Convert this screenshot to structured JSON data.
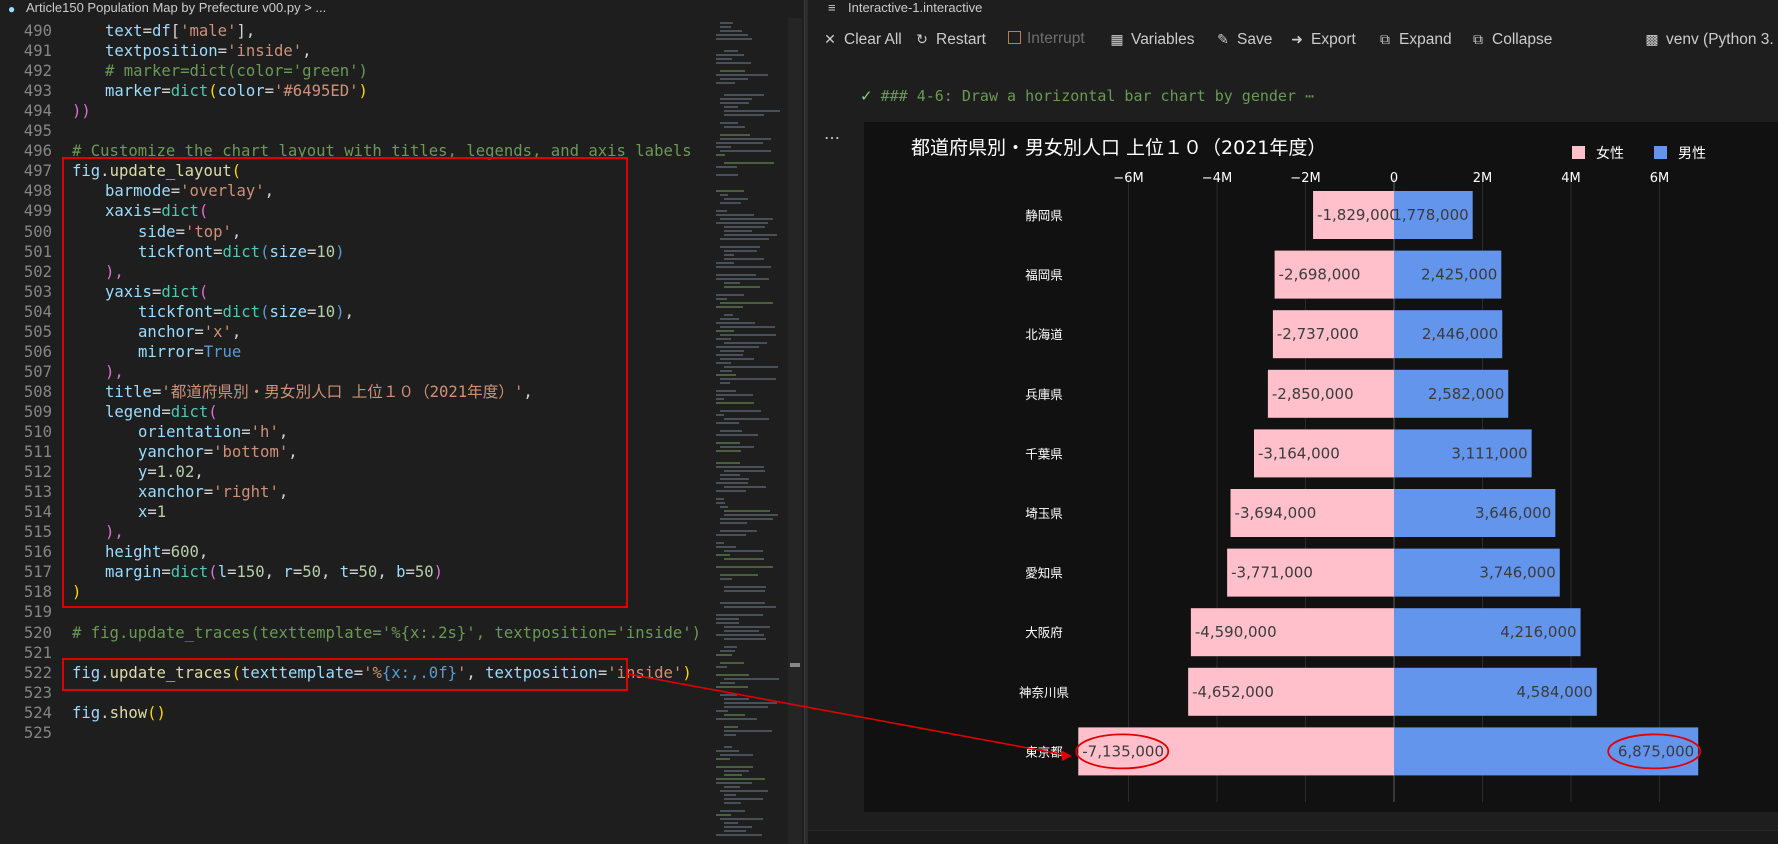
{
  "editor": {
    "breadcrumb": "Article150 Population Map by Prefecture v00.py > ...",
    "lines": [
      {
        "n": "490",
        "tokens": [
          [
            "t-var",
            "text"
          ],
          [
            "",
            "="
          ],
          [
            "t-var",
            "df"
          ],
          [
            "",
            "["
          ],
          [
            "t-str",
            "'male'"
          ],
          [
            "",
            "],"
          ]
        ]
      },
      {
        "n": "491",
        "tokens": [
          [
            "t-var",
            "textposition"
          ],
          [
            "",
            "="
          ],
          [
            "t-str",
            "'inside'"
          ],
          [
            "",
            ","
          ]
        ]
      },
      {
        "n": "492",
        "tokens": [
          [
            "t-com",
            "# marker=dict(color='green')"
          ]
        ]
      },
      {
        "n": "493",
        "tokens": [
          [
            "t-var",
            "marker"
          ],
          [
            "",
            "="
          ],
          [
            "t-cls",
            "dict"
          ],
          [
            "t-p2",
            "("
          ],
          [
            "t-var",
            "color"
          ],
          [
            "",
            "="
          ],
          [
            "t-str",
            "'#6495ED'"
          ],
          [
            "t-p2",
            ")"
          ]
        ]
      },
      {
        "n": "494",
        "tokens": [
          [
            "t-p1",
            "))"
          ]
        ]
      },
      {
        "n": "495",
        "tokens": []
      },
      {
        "n": "496",
        "tokens": [
          [
            "t-com",
            "# Customize the chart layout with titles, legends, and axis labels"
          ]
        ]
      },
      {
        "n": "497",
        "tokens": [
          [
            "t-var",
            "fig"
          ],
          [
            "",
            "."
          ],
          [
            "t-fn",
            "update_layout"
          ],
          [
            "t-p2",
            "("
          ]
        ]
      },
      {
        "n": "498",
        "tokens": [
          [
            "t-var",
            "barmode"
          ],
          [
            "",
            "="
          ],
          [
            "t-str",
            "'overlay'"
          ],
          [
            "",
            ","
          ]
        ]
      },
      {
        "n": "499",
        "tokens": [
          [
            "t-var",
            "xaxis"
          ],
          [
            "",
            "="
          ],
          [
            "t-cls",
            "dict"
          ],
          [
            "t-p1",
            "("
          ]
        ]
      },
      {
        "n": "500",
        "tokens": [
          [
            "t-var",
            "side"
          ],
          [
            "",
            "="
          ],
          [
            "t-str",
            "'top'"
          ],
          [
            "",
            ","
          ]
        ]
      },
      {
        "n": "501",
        "tokens": [
          [
            "t-var",
            "tickfont"
          ],
          [
            "",
            "="
          ],
          [
            "t-cls",
            "dict"
          ],
          [
            "t-kw",
            "("
          ],
          [
            "t-var",
            "size"
          ],
          [
            "",
            "="
          ],
          [
            "t-num",
            "10"
          ],
          [
            "t-kw",
            ")"
          ]
        ]
      },
      {
        "n": "502",
        "tokens": [
          [
            "t-p1",
            "),"
          ]
        ]
      },
      {
        "n": "503",
        "tokens": [
          [
            "t-var",
            "yaxis"
          ],
          [
            "",
            "="
          ],
          [
            "t-cls",
            "dict"
          ],
          [
            "t-p1",
            "("
          ]
        ]
      },
      {
        "n": "504",
        "tokens": [
          [
            "t-var",
            "tickfont"
          ],
          [
            "",
            "="
          ],
          [
            "t-cls",
            "dict"
          ],
          [
            "t-kw",
            "("
          ],
          [
            "t-var",
            "size"
          ],
          [
            "",
            "="
          ],
          [
            "t-num",
            "10"
          ],
          [
            "t-kw",
            ")"
          ],
          [
            "",
            ","
          ]
        ]
      },
      {
        "n": "505",
        "tokens": [
          [
            "t-var",
            "anchor"
          ],
          [
            "",
            "="
          ],
          [
            "t-str",
            "'x'"
          ],
          [
            "",
            ","
          ]
        ]
      },
      {
        "n": "506",
        "tokens": [
          [
            "t-var",
            "mirror"
          ],
          [
            "",
            "="
          ],
          [
            "t-kw",
            "True"
          ]
        ]
      },
      {
        "n": "507",
        "tokens": [
          [
            "t-p1",
            "),"
          ]
        ]
      },
      {
        "n": "508",
        "tokens": [
          [
            "t-var",
            "title"
          ],
          [
            "",
            "="
          ],
          [
            "t-str",
            "'都道府県別・男女別人口 上位１０（2021年度）'"
          ],
          [
            "",
            ","
          ]
        ]
      },
      {
        "n": "509",
        "tokens": [
          [
            "t-var",
            "legend"
          ],
          [
            "",
            "="
          ],
          [
            "t-cls",
            "dict"
          ],
          [
            "t-p1",
            "("
          ]
        ]
      },
      {
        "n": "510",
        "tokens": [
          [
            "t-var",
            "orientation"
          ],
          [
            "",
            "="
          ],
          [
            "t-str",
            "'h'"
          ],
          [
            "",
            ","
          ]
        ]
      },
      {
        "n": "511",
        "tokens": [
          [
            "t-var",
            "yanchor"
          ],
          [
            "",
            "="
          ],
          [
            "t-str",
            "'bottom'"
          ],
          [
            "",
            ","
          ]
        ]
      },
      {
        "n": "512",
        "tokens": [
          [
            "t-var",
            "y"
          ],
          [
            "",
            "="
          ],
          [
            "t-num",
            "1.02"
          ],
          [
            "",
            ","
          ]
        ]
      },
      {
        "n": "513",
        "tokens": [
          [
            "t-var",
            "xanchor"
          ],
          [
            "",
            "="
          ],
          [
            "t-str",
            "'right'"
          ],
          [
            "",
            ","
          ]
        ]
      },
      {
        "n": "514",
        "tokens": [
          [
            "t-var",
            "x"
          ],
          [
            "",
            "="
          ],
          [
            "t-num",
            "1"
          ]
        ]
      },
      {
        "n": "515",
        "tokens": [
          [
            "t-p1",
            "),"
          ]
        ]
      },
      {
        "n": "516",
        "tokens": [
          [
            "t-var",
            "height"
          ],
          [
            "",
            "="
          ],
          [
            "t-num",
            "600"
          ],
          [
            "",
            ","
          ]
        ]
      },
      {
        "n": "517",
        "tokens": [
          [
            "t-var",
            "margin"
          ],
          [
            "",
            "="
          ],
          [
            "t-cls",
            "dict"
          ],
          [
            "t-p1",
            "("
          ],
          [
            "t-var",
            "l"
          ],
          [
            "",
            "="
          ],
          [
            "t-num",
            "150"
          ],
          [
            "",
            ", "
          ],
          [
            "t-var",
            "r"
          ],
          [
            "",
            "="
          ],
          [
            "t-num",
            "50"
          ],
          [
            "",
            ", "
          ],
          [
            "t-var",
            "t"
          ],
          [
            "",
            "="
          ],
          [
            "t-num",
            "50"
          ],
          [
            "",
            ", "
          ],
          [
            "t-var",
            "b"
          ],
          [
            "",
            "="
          ],
          [
            "t-num",
            "50"
          ],
          [
            "t-p1",
            ")"
          ]
        ]
      },
      {
        "n": "518",
        "tokens": [
          [
            "t-p2",
            ")"
          ]
        ]
      },
      {
        "n": "519",
        "tokens": []
      },
      {
        "n": "520",
        "tokens": [
          [
            "t-com",
            "# fig.update_traces(texttemplate='%{x:.2s}', textposition='inside')"
          ]
        ]
      },
      {
        "n": "521",
        "tokens": []
      },
      {
        "n": "522",
        "tokens": [
          [
            "t-var",
            "fig"
          ],
          [
            "",
            "."
          ],
          [
            "t-fn",
            "update_traces"
          ],
          [
            "t-p2",
            "("
          ],
          [
            "t-var",
            "texttemplate"
          ],
          [
            "",
            "="
          ],
          [
            "t-str",
            "'%"
          ],
          [
            "t-kw",
            "{x:,.0f}"
          ],
          [
            "t-str",
            "'"
          ],
          [
            "",
            ", "
          ],
          [
            "t-var",
            "textposition"
          ],
          [
            "",
            "="
          ],
          [
            "t-str",
            "'inside'"
          ],
          [
            "t-p2",
            ")"
          ]
        ]
      },
      {
        "n": "523",
        "tokens": []
      },
      {
        "n": "524",
        "tokens": [
          [
            "t-var",
            "fig"
          ],
          [
            "",
            "."
          ],
          [
            "t-fn",
            "show"
          ],
          [
            "t-p2",
            "()"
          ]
        ]
      },
      {
        "n": "525",
        "tokens": []
      }
    ]
  },
  "panel": {
    "title": "Interactive-1.interactive",
    "toolbar": {
      "clear_all": "Clear All",
      "restart": "Restart",
      "interrupt": "Interrupt",
      "variables": "Variables",
      "save": "Save",
      "export": "Export",
      "expand": "Expand",
      "collapse": "Collapse",
      "kernel": "venv (Python 3."
    },
    "cell_status": "### 4-6: Draw a horizontal bar chart by gender ⋯",
    "cell_more": "…"
  },
  "chart_data": {
    "type": "bar",
    "orientation": "horizontal",
    "barmode": "overlay",
    "title": "都道府県別・男女別人口 上位１０（2021年度）",
    "categories": [
      "静岡県",
      "福岡県",
      "北海道",
      "兵庫県",
      "千葉県",
      "埼玉県",
      "愛知県",
      "大阪府",
      "神奈川県",
      "東京都"
    ],
    "series": [
      {
        "name": "女性",
        "color": "#FFC0CB",
        "values": [
          -1829000,
          -2698000,
          -2737000,
          -2850000,
          -3164000,
          -3694000,
          -3771000,
          -4590000,
          -4652000,
          -7135000
        ],
        "labels": [
          "-1,829,000",
          "-2,698,000",
          "-2,737,000",
          "-2,850,000",
          "-3,164,000",
          "-3,694,000",
          "-3,771,000",
          "-4,590,000",
          "-4,652,000",
          "-7,135,000"
        ]
      },
      {
        "name": "男性",
        "color": "#6495ED",
        "values": [
          1778000,
          2425000,
          2446000,
          2582000,
          3111000,
          3646000,
          3746000,
          4216000,
          4584000,
          6875000
        ],
        "labels": [
          "1,778,000",
          "2,425,000",
          "2,446,000",
          "2,582,000",
          "3,111,000",
          "3,646,000",
          "3,746,000",
          "4,216,000",
          "4,584,000",
          "6,875,000"
        ]
      }
    ],
    "xticks": [
      -6000000,
      -4000000,
      -2000000,
      0,
      2000000,
      4000000,
      6000000
    ],
    "xtick_labels": [
      "−6M",
      "−4M",
      "−2M",
      "0",
      "2M",
      "4M",
      "6M"
    ],
    "xlim": [
      -7200000,
      7600000
    ],
    "xaxis_side": "top",
    "legend_position": "top-right",
    "background": "#111111",
    "highlighted_category": "東京都"
  }
}
